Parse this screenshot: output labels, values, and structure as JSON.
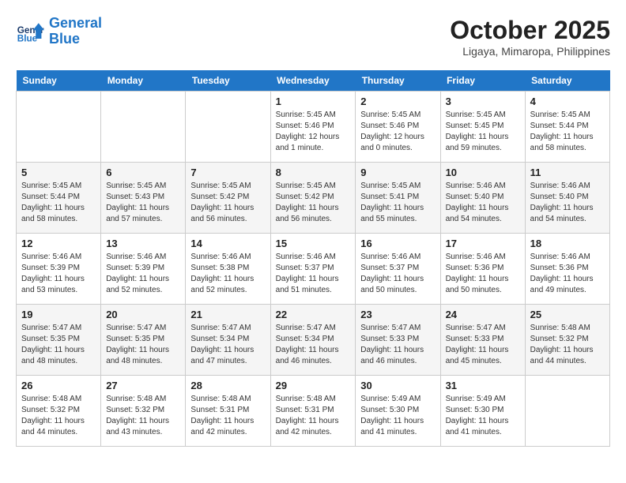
{
  "header": {
    "logo_line1": "General",
    "logo_line2": "Blue",
    "month_title": "October 2025",
    "location": "Ligaya, Mimaropa, Philippines"
  },
  "days_of_week": [
    "Sunday",
    "Monday",
    "Tuesday",
    "Wednesday",
    "Thursday",
    "Friday",
    "Saturday"
  ],
  "weeks": [
    [
      {
        "day": "",
        "info": ""
      },
      {
        "day": "",
        "info": ""
      },
      {
        "day": "",
        "info": ""
      },
      {
        "day": "1",
        "info": "Sunrise: 5:45 AM\nSunset: 5:46 PM\nDaylight: 12 hours\nand 1 minute."
      },
      {
        "day": "2",
        "info": "Sunrise: 5:45 AM\nSunset: 5:46 PM\nDaylight: 12 hours\nand 0 minutes."
      },
      {
        "day": "3",
        "info": "Sunrise: 5:45 AM\nSunset: 5:45 PM\nDaylight: 11 hours\nand 59 minutes."
      },
      {
        "day": "4",
        "info": "Sunrise: 5:45 AM\nSunset: 5:44 PM\nDaylight: 11 hours\nand 58 minutes."
      }
    ],
    [
      {
        "day": "5",
        "info": "Sunrise: 5:45 AM\nSunset: 5:44 PM\nDaylight: 11 hours\nand 58 minutes."
      },
      {
        "day": "6",
        "info": "Sunrise: 5:45 AM\nSunset: 5:43 PM\nDaylight: 11 hours\nand 57 minutes."
      },
      {
        "day": "7",
        "info": "Sunrise: 5:45 AM\nSunset: 5:42 PM\nDaylight: 11 hours\nand 56 minutes."
      },
      {
        "day": "8",
        "info": "Sunrise: 5:45 AM\nSunset: 5:42 PM\nDaylight: 11 hours\nand 56 minutes."
      },
      {
        "day": "9",
        "info": "Sunrise: 5:45 AM\nSunset: 5:41 PM\nDaylight: 11 hours\nand 55 minutes."
      },
      {
        "day": "10",
        "info": "Sunrise: 5:46 AM\nSunset: 5:40 PM\nDaylight: 11 hours\nand 54 minutes."
      },
      {
        "day": "11",
        "info": "Sunrise: 5:46 AM\nSunset: 5:40 PM\nDaylight: 11 hours\nand 54 minutes."
      }
    ],
    [
      {
        "day": "12",
        "info": "Sunrise: 5:46 AM\nSunset: 5:39 PM\nDaylight: 11 hours\nand 53 minutes."
      },
      {
        "day": "13",
        "info": "Sunrise: 5:46 AM\nSunset: 5:39 PM\nDaylight: 11 hours\nand 52 minutes."
      },
      {
        "day": "14",
        "info": "Sunrise: 5:46 AM\nSunset: 5:38 PM\nDaylight: 11 hours\nand 52 minutes."
      },
      {
        "day": "15",
        "info": "Sunrise: 5:46 AM\nSunset: 5:37 PM\nDaylight: 11 hours\nand 51 minutes."
      },
      {
        "day": "16",
        "info": "Sunrise: 5:46 AM\nSunset: 5:37 PM\nDaylight: 11 hours\nand 50 minutes."
      },
      {
        "day": "17",
        "info": "Sunrise: 5:46 AM\nSunset: 5:36 PM\nDaylight: 11 hours\nand 50 minutes."
      },
      {
        "day": "18",
        "info": "Sunrise: 5:46 AM\nSunset: 5:36 PM\nDaylight: 11 hours\nand 49 minutes."
      }
    ],
    [
      {
        "day": "19",
        "info": "Sunrise: 5:47 AM\nSunset: 5:35 PM\nDaylight: 11 hours\nand 48 minutes."
      },
      {
        "day": "20",
        "info": "Sunrise: 5:47 AM\nSunset: 5:35 PM\nDaylight: 11 hours\nand 48 minutes."
      },
      {
        "day": "21",
        "info": "Sunrise: 5:47 AM\nSunset: 5:34 PM\nDaylight: 11 hours\nand 47 minutes."
      },
      {
        "day": "22",
        "info": "Sunrise: 5:47 AM\nSunset: 5:34 PM\nDaylight: 11 hours\nand 46 minutes."
      },
      {
        "day": "23",
        "info": "Sunrise: 5:47 AM\nSunset: 5:33 PM\nDaylight: 11 hours\nand 46 minutes."
      },
      {
        "day": "24",
        "info": "Sunrise: 5:47 AM\nSunset: 5:33 PM\nDaylight: 11 hours\nand 45 minutes."
      },
      {
        "day": "25",
        "info": "Sunrise: 5:48 AM\nSunset: 5:32 PM\nDaylight: 11 hours\nand 44 minutes."
      }
    ],
    [
      {
        "day": "26",
        "info": "Sunrise: 5:48 AM\nSunset: 5:32 PM\nDaylight: 11 hours\nand 44 minutes."
      },
      {
        "day": "27",
        "info": "Sunrise: 5:48 AM\nSunset: 5:32 PM\nDaylight: 11 hours\nand 43 minutes."
      },
      {
        "day": "28",
        "info": "Sunrise: 5:48 AM\nSunset: 5:31 PM\nDaylight: 11 hours\nand 42 minutes."
      },
      {
        "day": "29",
        "info": "Sunrise: 5:48 AM\nSunset: 5:31 PM\nDaylight: 11 hours\nand 42 minutes."
      },
      {
        "day": "30",
        "info": "Sunrise: 5:49 AM\nSunset: 5:30 PM\nDaylight: 11 hours\nand 41 minutes."
      },
      {
        "day": "31",
        "info": "Sunrise: 5:49 AM\nSunset: 5:30 PM\nDaylight: 11 hours\nand 41 minutes."
      },
      {
        "day": "",
        "info": ""
      }
    ]
  ]
}
